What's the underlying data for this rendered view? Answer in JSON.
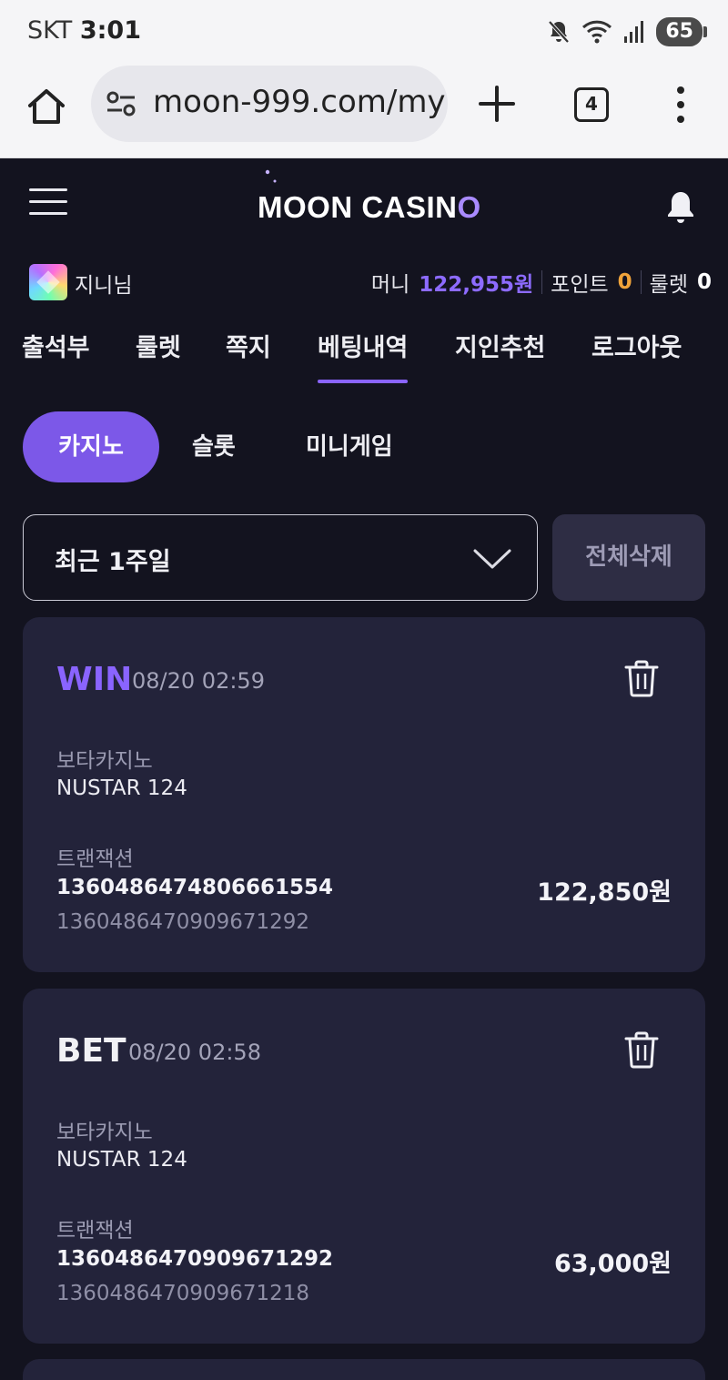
{
  "status_bar": {
    "carrier": "SKT",
    "time": "3:01",
    "battery": "65"
  },
  "browser": {
    "url": "moon-999.com/my",
    "tab_count": "4"
  },
  "header": {
    "logo_main": "MOON CASIN",
    "logo_accent": "O"
  },
  "user": {
    "name": "지니님",
    "money_label": "머니",
    "money_value": "122,955원",
    "point_label": "포인트",
    "point_value": "0",
    "roulette_label": "룰렛",
    "roulette_value": "0"
  },
  "nav": [
    "출석부",
    "룰렛",
    "쪽지",
    "베팅내역",
    "지인추천",
    "로그아웃"
  ],
  "categories": [
    "카지노",
    "슬롯",
    "미니게임"
  ],
  "filter": {
    "period": "최근 1주일",
    "delete_all": "전체삭제"
  },
  "records": [
    {
      "status": "WIN",
      "datetime": "08/20 02:59",
      "provider": "보타카지노",
      "table": "NUSTAR 124",
      "tx_label": "트랜잭션",
      "tx_main": "1360486474806661554",
      "tx_sub": "1360486470909671292",
      "amount": "122,850원"
    },
    {
      "status": "BET",
      "datetime": "08/20 02:58",
      "provider": "보타카지노",
      "table": "NUSTAR 124",
      "tx_label": "트랜잭션",
      "tx_main": "1360486470909671292",
      "tx_sub": "1360486470909671218",
      "amount": "63,000원"
    }
  ],
  "colors": {
    "accent": "#8a64ff",
    "point": "#f0a33a",
    "card": "#23233a",
    "background": "#13131f"
  }
}
